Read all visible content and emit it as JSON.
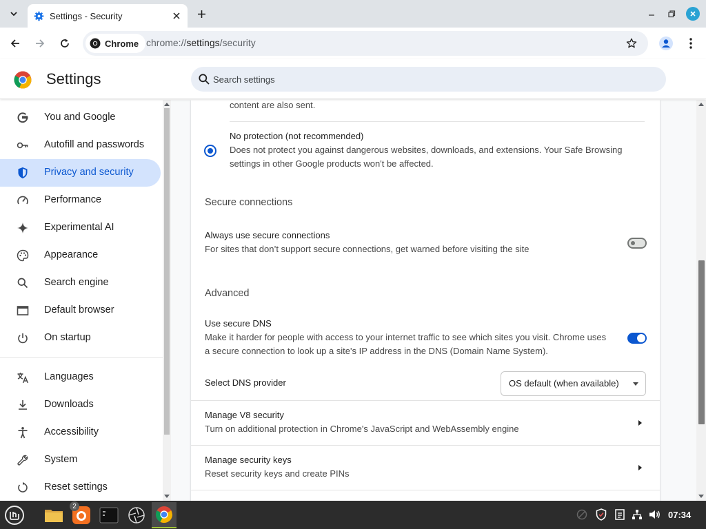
{
  "browser": {
    "tab_title": "Settings - Security",
    "chip_label": "Chrome",
    "url_scheme": "chrome://",
    "url_host": "settings",
    "url_path": "/security"
  },
  "header": {
    "title": "Settings",
    "search_placeholder": "Search settings"
  },
  "sidebar": {
    "items": [
      {
        "label": "You and Google",
        "icon": "google-icon"
      },
      {
        "label": "Autofill and passwords",
        "icon": "key-icon"
      },
      {
        "label": "Privacy and security",
        "icon": "shield-icon"
      },
      {
        "label": "Performance",
        "icon": "speedometer-icon"
      },
      {
        "label": "Experimental AI",
        "icon": "sparkle-icon"
      },
      {
        "label": "Appearance",
        "icon": "palette-icon"
      },
      {
        "label": "Search engine",
        "icon": "search-icon"
      },
      {
        "label": "Default browser",
        "icon": "browser-window-icon"
      },
      {
        "label": "On startup",
        "icon": "power-icon"
      },
      {
        "label": "Languages",
        "icon": "translate-icon"
      },
      {
        "label": "Downloads",
        "icon": "download-icon"
      },
      {
        "label": "Accessibility",
        "icon": "accessibility-icon"
      },
      {
        "label": "System",
        "icon": "wrench-icon"
      },
      {
        "label": "Reset settings",
        "icon": "reset-icon"
      }
    ],
    "active_index": 2
  },
  "content": {
    "prev_line": "content are also sent.",
    "no_protection": {
      "title": "No protection (not recommended)",
      "desc1": "Does not protect you against dangerous websites, downloads, and extensions. Your Safe Browsing",
      "desc2": "settings in other Google products won't be affected.",
      "selected": true
    },
    "secure_connections": {
      "heading": "Secure connections",
      "title": "Always use secure connections",
      "desc": "For sites that don’t support secure connections, get warned before visiting the site",
      "enabled": false
    },
    "advanced": {
      "heading": "Advanced",
      "dns_title": "Use secure DNS",
      "dns_desc1": "Make it harder for people with access to your internet traffic to see which sites you visit. Chrome uses",
      "dns_desc2": "a secure connection to look up a site's IP address in the DNS (Domain Name System).",
      "dns_enabled": true,
      "provider_label": "Select DNS provider",
      "provider_value": "OS default (when available)",
      "v8_title": "Manage V8 security",
      "v8_desc": "Turn on additional protection in Chrome's JavaScript and WebAssembly engine",
      "keys_title": "Manage security keys",
      "keys_desc": "Reset security keys and create PINs"
    }
  },
  "taskbar": {
    "badge_count": "2",
    "clock": "07:34"
  },
  "colors": {
    "accent": "#0b57d0",
    "active_nav_bg": "#d3e3fd"
  }
}
